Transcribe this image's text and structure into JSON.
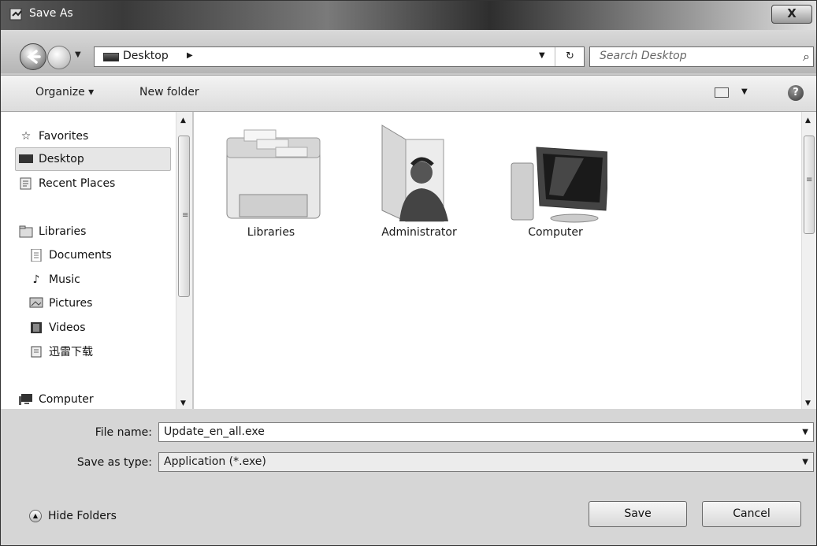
{
  "window": {
    "title": "Save As",
    "close_glyph": "X"
  },
  "address": {
    "location": "Desktop",
    "search_placeholder": "Search Desktop"
  },
  "toolbar": {
    "organize": "Organize ▾",
    "new_folder": "New folder",
    "help_glyph": "?"
  },
  "nav": {
    "items": [
      {
        "label": "Favorites",
        "icon": "star-icon"
      },
      {
        "label": "Desktop",
        "icon": "desktop-icon",
        "selected": true
      },
      {
        "label": "Recent Places",
        "icon": "recent-places-icon"
      },
      {
        "label": "Libraries",
        "icon": "libraries-icon"
      },
      {
        "label": "Documents",
        "icon": "document-icon"
      },
      {
        "label": "Music",
        "icon": "music-icon"
      },
      {
        "label": "Pictures",
        "icon": "pictures-icon"
      },
      {
        "label": "Videos",
        "icon": "videos-icon"
      },
      {
        "label": "迅雷下载",
        "icon": "download-folder-icon"
      },
      {
        "label": "Computer",
        "icon": "computer-icon"
      }
    ]
  },
  "content": {
    "items": [
      {
        "label": "Libraries",
        "icon": "libraries-folder-icon"
      },
      {
        "label": "Administrator",
        "icon": "user-folder-icon"
      },
      {
        "label": "Computer",
        "icon": "computer-monitor-icon"
      }
    ]
  },
  "form": {
    "file_name_label": "File name:",
    "file_name_value": "Update_en_all.exe",
    "save_type_label": "Save as type:",
    "save_type_value": "Application (*.exe)"
  },
  "footer": {
    "hide_folders": "Hide Folders",
    "save": "Save",
    "cancel": "Cancel"
  }
}
